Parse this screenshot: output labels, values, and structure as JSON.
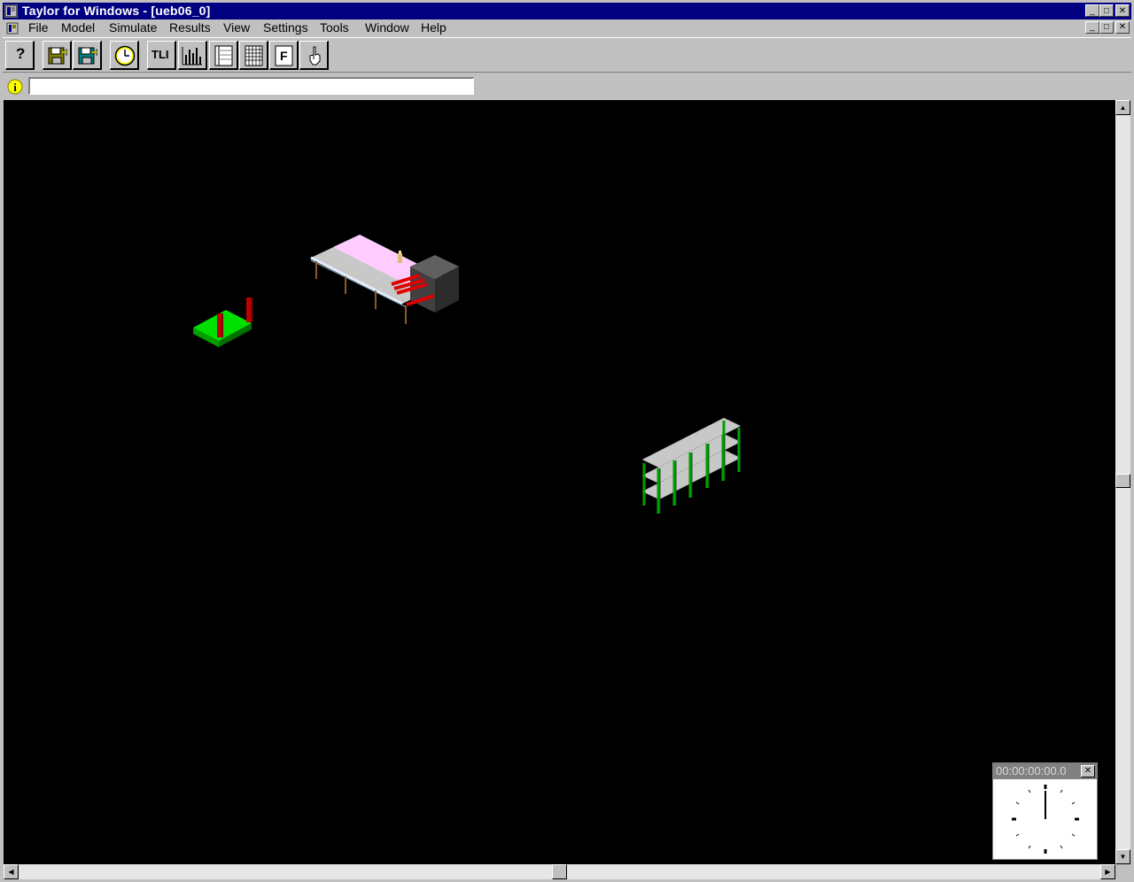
{
  "window": {
    "title": "Taylor for Windows - [ueb06_0]",
    "controls": {
      "minimize": "_",
      "maximize": "□",
      "close": "✕"
    }
  },
  "menu": {
    "items": [
      "File",
      "Model",
      "Simulate",
      "Results",
      "View",
      "Settings",
      "Tools",
      "Window",
      "Help"
    ]
  },
  "toolbar": {
    "help_label": "?",
    "tli_label": "TLI",
    "f_label": "F",
    "buttons": [
      "help",
      "open",
      "save",
      "clock",
      "tli",
      "chart",
      "list",
      "grid",
      "f-panel",
      "pointer"
    ]
  },
  "infobar": {
    "status_text": ""
  },
  "clock": {
    "time": "00:00:00:00.0"
  },
  "colors": {
    "titlebar": "#000080",
    "face": "#c0c0c0",
    "viewport": "#000000"
  }
}
